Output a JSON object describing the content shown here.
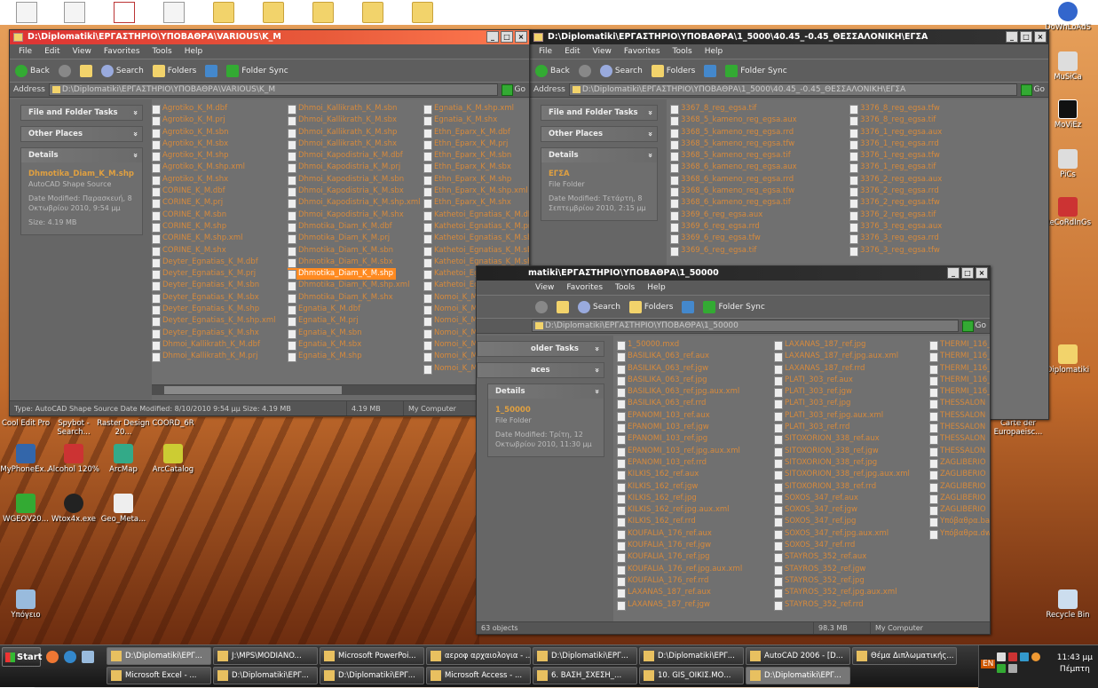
{
  "desktop": {
    "left_icons": [
      {
        "label": "Cool Edit Pro",
        "color": "#3a3a3a"
      },
      {
        "label": "Spybot - Search...",
        "color": "#ccc"
      },
      {
        "label": "Raster Design 20...",
        "color": "#556"
      },
      {
        "label": "COORD_6R",
        "color": "#777"
      },
      {
        "label": "MyPhoneEx...",
        "color": "#36a"
      },
      {
        "label": "Alcohol 120%",
        "color": "#c33"
      },
      {
        "label": "ArcMap",
        "color": "#3a8"
      },
      {
        "label": "ArcCatalog",
        "color": "#cc3"
      },
      {
        "label": "WGEOV20...",
        "color": "#3a3"
      },
      {
        "label": "Wtox4x.exe",
        "color": "#222"
      },
      {
        "label": "Geo_Meta...",
        "color": "#eee"
      },
      {
        "label": "Υπόγειο",
        "color": "#9bd"
      }
    ],
    "right_icons": [
      {
        "label": "DoWnLoAdS",
        "color": "#36c"
      },
      {
        "label": "MuSiCa",
        "color": "#ddd"
      },
      {
        "label": "MoViEz",
        "color": "#111"
      },
      {
        "label": "PiCs",
        "color": "#ddd"
      },
      {
        "label": "ReCoRdInGs",
        "color": "#c33"
      },
      {
        "label": "Diplomatiki",
        "color": "#f2d36b"
      },
      {
        "label": "Carte der Europaeisc...",
        "color": "#555"
      },
      {
        "label": "Recycle Bin",
        "color": "#cde"
      }
    ]
  },
  "win1": {
    "title": "D:\\Diplomatiki\\ΕΡΓΑΣΤΗΡΙΟ\\ΥΠΟΒΑΘΡΑ\\VARIOUS\\K_M",
    "menu": [
      "File",
      "Edit",
      "View",
      "Favorites",
      "Tools",
      "Help"
    ],
    "toolbar": {
      "back": "Back",
      "search": "Search",
      "folders": "Folders",
      "sync": "Folder Sync"
    },
    "address_label": "Address",
    "address": "D:\\Diplomatiki\\ΕΡΓΑΣΤΗΡΙΟ\\ΥΠΟΒΑΘΡΑ\\VARIOUS\\K_M",
    "go": "Go",
    "panels": {
      "tasks": "File and Folder Tasks",
      "other": "Other Places",
      "details": "Details"
    },
    "details": {
      "name": "Dhmotika_Diam_K_M.shp",
      "type": "AutoCAD Shape Source",
      "modified": "Date Modified: Παρασκευή, 8 Οκτωβρίου 2010, 9:54 μμ",
      "size": "Size: 4.19 MB"
    },
    "col1": [
      "Agrotiko_K_M.dbf",
      "Agrotiko_K_M.prj",
      "Agrotiko_K_M.sbn",
      "Agrotiko_K_M.sbx",
      "Agrotiko_K_M.shp",
      "Agrotiko_K_M.shp.xml",
      "Agrotiko_K_M.shx",
      "CORINE_K_M.dbf",
      "CORINE_K_M.prj",
      "CORINE_K_M.sbn",
      "CORINE_K_M.shp",
      "CORINE_K_M.shp.xml",
      "CORINE_K_M.shx",
      "Deyter_Egnatias_K_M.dbf",
      "Deyter_Egnatias_K_M.prj",
      "Deyter_Egnatias_K_M.sbn",
      "Deyter_Egnatias_K_M.sbx",
      "Deyter_Egnatias_K_M.shp",
      "Deyter_Egnatias_K_M.shp.xml",
      "Deyter_Egnatias_K_M.shx",
      "Dhmoi_Kallikrath_K_M.dbf",
      "Dhmoi_Kallikrath_K_M.prj"
    ],
    "col2": [
      "Dhmoi_Kallikrath_K_M.sbn",
      "Dhmoi_Kallikrath_K_M.sbx",
      "Dhmoi_Kallikrath_K_M.shp",
      "Dhmoi_Kallikrath_K_M.shx",
      "Dhmoi_Kapodistria_K_M.dbf",
      "Dhmoi_Kapodistria_K_M.prj",
      "Dhmoi_Kapodistria_K_M.sbn",
      "Dhmoi_Kapodistria_K_M.sbx",
      "Dhmoi_Kapodistria_K_M.shp.xml",
      "Dhmoi_Kapodistria_K_M.shx",
      "Dhmotika_Diam_K_M.dbf",
      "Dhmotika_Diam_K_M.prj",
      "Dhmotika_Diam_K_M.sbn",
      "Dhmotika_Diam_K_M.sbx",
      "Dhmotika_Diam_K_M.shp",
      "Dhmotika_Diam_K_M.shp.xml",
      "Dhmotika_Diam_K_M.shx",
      "Egnatia_K_M.dbf",
      "Egnatia_K_M.prj",
      "Egnatia_K_M.sbn",
      "Egnatia_K_M.sbx",
      "Egnatia_K_M.shp"
    ],
    "col3": [
      "Egnatia_K_M.shp.xml",
      "Egnatia_K_M.shx",
      "Ethn_Eparx_K_M.dbf",
      "Ethn_Eparx_K_M.prj",
      "Ethn_Eparx_K_M.sbn",
      "Ethn_Eparx_K_M.sbx",
      "Ethn_Eparx_K_M.shp",
      "Ethn_Eparx_K_M.shp.xml",
      "Ethn_Eparx_K_M.shx",
      "Kathetoi_Egnatias_K_M.dbf",
      "Kathetoi_Egnatias_K_M.prj",
      "Kathetoi_Egnatias_K_M.sbn",
      "Kathetoi_Egnatias_K_M.sbx",
      "Kathetoi_Egnatias_K_M.shp",
      "Kathetoi_Egnatias_K_M.shp.xml",
      "Kathetoi_Egnatias_K_M.shx",
      "Nomoi_K_M.dbf",
      "Nomoi_K_M.prj",
      "Nomoi_K_M.sbn",
      "Nomoi_K_M.sbx",
      "Nomoi_K_M.shp",
      "Nomoi_K_M.shp.xml",
      "Nomoi_K_M.shx"
    ],
    "status_main": "Type: AutoCAD Shape Source Date Modified: 8/10/2010 9:54 μμ Size: 4.19 MB",
    "status_size": "4.19 MB",
    "status_loc": "My Computer"
  },
  "win2": {
    "title": "D:\\Diplomatiki\\ΕΡΓΑΣΤΗΡΙΟ\\ΥΠΟΒΑΘΡΑ\\1_5000\\40.45_-0.45_ΘΕΣΣΑΛΟΝΙΚΗ\\ΕΓΣΑ",
    "menu": [
      "File",
      "Edit",
      "View",
      "Favorites",
      "Tools",
      "Help"
    ],
    "address": "D:\\Diplomatiki\\ΕΡΓΑΣΤΗΡΙΟ\\ΥΠΟΒΑΘΡΑ\\1_5000\\40.45_-0.45_ΘΕΣΣΑΛΟΝΙΚΗ\\ΕΓΣΑ",
    "details": {
      "name": "ΕΓΣΑ",
      "type": "File Folder",
      "modified": "Date Modified: Τετάρτη, 8 Σεπτεμβρίου 2010, 2:15 μμ"
    },
    "col1": [
      "3367_8_reg_egsa.tif",
      "3368_5_kameno_reg_egsa.aux",
      "3368_5_kameno_reg_egsa.rrd",
      "3368_5_kameno_reg_egsa.tfw",
      "3368_5_kameno_reg_egsa.tif",
      "3368_6_kameno_reg_egsa.aux",
      "3368_6_kameno_reg_egsa.rrd",
      "3368_6_kameno_reg_egsa.tfw",
      "3368_6_kameno_reg_egsa.tif",
      "3369_6_reg_egsa.aux",
      "3369_6_reg_egsa.rrd",
      "3369_6_reg_egsa.tfw",
      "3369_6_reg_egsa.tif"
    ],
    "col2": [
      "3376_8_reg_egsa.tfw",
      "3376_8_reg_egsa.tif",
      "3376_1_reg_egsa.aux",
      "3376_1_reg_egsa.rrd",
      "3376_1_reg_egsa.tfw",
      "3376_1_reg_egsa.tif",
      "3376_2_reg_egsa.aux",
      "3376_2_reg_egsa.rrd",
      "3376_2_reg_egsa.tfw",
      "3376_2_reg_egsa.tif",
      "3376_3_reg_egsa.aux",
      "3376_3_reg_egsa.rrd",
      "3376_3_reg_egsa.tfw"
    ]
  },
  "win3": {
    "title": "D:\\Diplomatiki\\ΕΡΓΑΣΤΗΡΙΟ\\ΥΠΟΒΑΘΡΑ\\1_50000",
    "title_visible": "matiki\\ΕΡΓΑΣΤΗΡΙΟ\\ΥΠΟΒΑΘΡΑ\\1_50000",
    "menu": [
      "View",
      "Favorites",
      "Tools",
      "Help"
    ],
    "address": "D:\\Diplomatiki\\ΕΡΓΑΣΤΗΡΙΟ\\ΥΠΟΒΑΘΡΑ\\1_50000",
    "panels": {
      "tasks": "older Tasks",
      "other": "aces"
    },
    "details": {
      "name": "1_50000",
      "type": "File Folder",
      "modified": "Date Modified: Τρίτη, 12 Οκτωβρίου 2010, 11:30 μμ"
    },
    "col1": [
      "1_50000.mxd",
      "BASILIKA_063_ref.aux",
      "BASILIKA_063_ref.jgw",
      "BASILIKA_063_ref.jpg",
      "BASILIKA_063_ref.jpg.aux.xml",
      "BASILIKA_063_ref.rrd",
      "EPANOMI_103_ref.aux",
      "EPANOMI_103_ref.jgw",
      "EPANOMI_103_ref.jpg",
      "EPANOMI_103_ref.jpg.aux.xml",
      "EPANOMI_103_ref.rrd",
      "KILKIS_162_ref.aux",
      "KILKIS_162_ref.jgw",
      "KILKIS_162_ref.jpg",
      "KILKIS_162_ref.jpg.aux.xml",
      "KILKIS_162_ref.rrd",
      "KOUFALIA_176_ref.aux",
      "KOUFALIA_176_ref.jgw",
      "KOUFALIA_176_ref.jpg",
      "KOUFALIA_176_ref.jpg.aux.xml",
      "KOUFALIA_176_ref.rrd",
      "LAXANAS_187_ref.aux",
      "LAXANAS_187_ref.jgw"
    ],
    "col2": [
      "LAXANAS_187_ref.jpg",
      "LAXANAS_187_ref.jpg.aux.xml",
      "LAXANAS_187_ref.rrd",
      "PLATI_303_ref.aux",
      "PLATI_303_ref.jgw",
      "PLATI_303_ref.jpg",
      "PLATI_303_ref.jpg.aux.xml",
      "PLATI_303_ref.rrd",
      "SITOXORION_338_ref.aux",
      "SITOXORION_338_ref.jgw",
      "SITOXORION_338_ref.jpg",
      "SITOXORION_338_ref.jpg.aux.xml",
      "SITOXORION_338_ref.rrd",
      "SOXOS_347_ref.aux",
      "SOXOS_347_ref.jgw",
      "SOXOS_347_ref.jpg",
      "SOXOS_347_ref.jpg.aux.xml",
      "SOXOS_347_ref.rrd",
      "STAYROS_352_ref.aux",
      "STAYROS_352_ref.jgw",
      "STAYROS_352_ref.jpg",
      "STAYROS_352_ref.jpg.aux.xml",
      "STAYROS_352_ref.rrd"
    ],
    "col3": [
      "THERMI_116_",
      "THERMI_116_",
      "THERMI_116_",
      "THERMI_116_",
      "THERMI_116_",
      "THESSALON",
      "THESSALON",
      "THESSALON",
      "THESSALON",
      "THESSALON",
      "ZAGLIBERIO",
      "ZAGLIBERIO",
      "ZAGLIBERIO",
      "ZAGLIBERIO",
      "ZAGLIBERIO",
      "Υπόβαθρα.bak",
      "Υπόβαθρα.dwg"
    ],
    "status_count": "63 objects",
    "status_size": "98.3 MB",
    "status_loc": "My Computer"
  },
  "taskbar": {
    "start": "Start",
    "row1": [
      "D:\\Diplomatiki\\ΕΡΓ...",
      "J:\\MPS\\MODIANO...",
      "Microsoft PowerPoi...",
      "αεροφ αρχαιολογια - ...",
      "D:\\Diplomatiki\\ΕΡΓ...",
      "D:\\Diplomatiki\\ΕΡΓ...",
      "AutoCAD 2006 - [D...",
      "Θέμα Διπλωματικής..."
    ],
    "row2": [
      "Microsoft Excel - ...",
      "D:\\Diplomatiki\\ΕΡΓ...",
      "D:\\Diplomatiki\\ΕΡΓ...",
      "Microsoft Access - ...",
      "6. ΒΑΣΗ_ΣΧΕΣΗ_...",
      "10. GIS_ΟΙΚΙΣ.ΜΟ...",
      "D:\\Diplomatiki\\ΕΡΓ..."
    ],
    "lang": "EN",
    "time": "11:43 μμ",
    "day": "Πέμπτη"
  }
}
